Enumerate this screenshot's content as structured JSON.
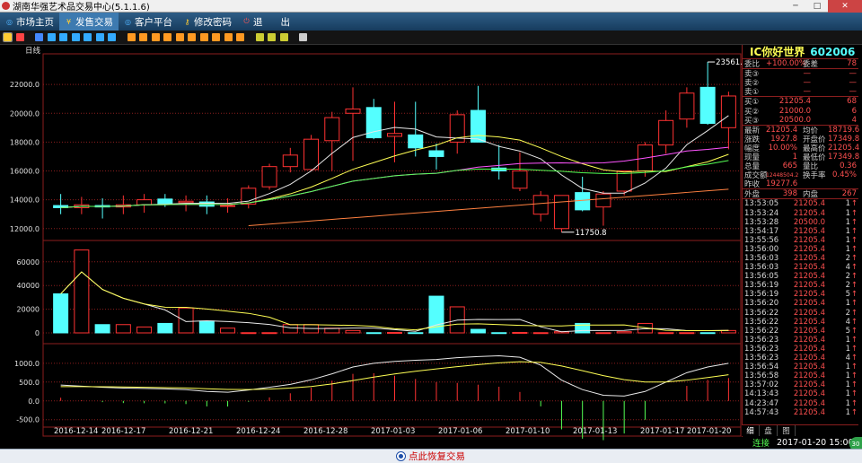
{
  "window": {
    "title": "湖南华强艺术品交易中心(5.1.1.6)"
  },
  "menu": [
    {
      "label": "市场主页",
      "icon": "globe-icon",
      "color": "#4fb3ff"
    },
    {
      "label": "发售交易",
      "icon": "yen-icon",
      "color": "#ffcc33"
    },
    {
      "label": "客户平台",
      "icon": "globe-icon",
      "color": "#4fb3ff"
    },
    {
      "label": "修改密码",
      "icon": "key-icon",
      "color": "#ffcc33"
    },
    {
      "label": "退",
      "icon": "power-icon",
      "color": "#ff5555"
    },
    {
      "label": "出",
      "icon": "",
      "color": ""
    }
  ],
  "toolbar": {
    "icons": [
      "bar-chart-icon",
      "line-chart-icon",
      "calendar-icon",
      "calendar-icon",
      "calendar-icon",
      "calendar-icon",
      "calendar-icon",
      "calendar-icon",
      "close-icon",
      "period-icon",
      "period-icon",
      "period-icon",
      "period-icon",
      "period-icon",
      "period-icon",
      "period-icon",
      "period-icon",
      "period-icon",
      "period-icon",
      "zoom-in-icon",
      "zoom-out-icon",
      "pencil-icon",
      "gear-icon"
    ]
  },
  "chart": {
    "period_label": "日线",
    "price_ticks": [
      "22000.0",
      "20000.0",
      "18000.0",
      "16000.0",
      "14000.0",
      "12000.0"
    ],
    "volume_ticks": [
      "60000",
      "40000",
      "20000",
      "0"
    ],
    "macd_ticks": [
      "1000.0",
      "500.0",
      "0.0",
      "-500.0"
    ],
    "max_label": "23561.6",
    "min_label": "11750.8",
    "dates": [
      "2016-12-14",
      "2016-12-17",
      "2016-12-21",
      "2016-12-24",
      "2016-12-28",
      "2017-01-03",
      "2017-01-06",
      "2017-01-10",
      "2017-01-13",
      "2017-01-17",
      "2017-01-20"
    ]
  },
  "chart_data": {
    "type": "candlestick",
    "y_range": [
      11300,
      24000
    ],
    "candles": [
      {
        "o": 13600,
        "h": 14400,
        "l": 13000,
        "c": 13450
      },
      {
        "o": 13450,
        "h": 14200,
        "l": 13000,
        "c": 13650
      },
      {
        "o": 13600,
        "h": 14100,
        "l": 12700,
        "c": 13500
      },
      {
        "o": 13500,
        "h": 14300,
        "l": 13000,
        "c": 13650
      },
      {
        "o": 13650,
        "h": 14400,
        "l": 13100,
        "c": 14000
      },
      {
        "o": 14050,
        "h": 14400,
        "l": 13500,
        "c": 13700
      },
      {
        "o": 13800,
        "h": 14300,
        "l": 13200,
        "c": 13900
      },
      {
        "o": 13850,
        "h": 14300,
        "l": 13000,
        "c": 13550
      },
      {
        "o": 13600,
        "h": 14100,
        "l": 13100,
        "c": 13600
      },
      {
        "o": 13700,
        "h": 15000,
        "l": 13400,
        "c": 14800
      },
      {
        "o": 14900,
        "h": 16500,
        "l": 14700,
        "c": 16300
      },
      {
        "o": 16300,
        "h": 17600,
        "l": 15900,
        "c": 17100
      },
      {
        "o": 16100,
        "h": 18500,
        "l": 16000,
        "c": 18200
      },
      {
        "o": 18100,
        "h": 20100,
        "l": 16000,
        "c": 19700
      },
      {
        "o": 20000,
        "h": 21800,
        "l": 16700,
        "c": 20300
      },
      {
        "o": 20400,
        "h": 21000,
        "l": 18200,
        "c": 18300
      },
      {
        "o": 18400,
        "h": 20800,
        "l": 16600,
        "c": 18600
      },
      {
        "o": 18500,
        "h": 20800,
        "l": 17000,
        "c": 17600
      },
      {
        "o": 17400,
        "h": 17900,
        "l": 16100,
        "c": 17000
      },
      {
        "o": 18000,
        "h": 20200,
        "l": 17200,
        "c": 19900
      },
      {
        "o": 20200,
        "h": 21900,
        "l": 18000,
        "c": 18000
      },
      {
        "o": 16200,
        "h": 17800,
        "l": 15400,
        "c": 16000
      },
      {
        "o": 14800,
        "h": 17300,
        "l": 14600,
        "c": 16000
      },
      {
        "o": 13000,
        "h": 14600,
        "l": 12500,
        "c": 14300
      },
      {
        "o": 12000,
        "h": 14300,
        "l": 11750.8,
        "c": 14300
      },
      {
        "o": 14500,
        "h": 15600,
        "l": 13200,
        "c": 13300
      },
      {
        "o": 13500,
        "h": 14600,
        "l": 12200,
        "c": 14400
      },
      {
        "o": 14600,
        "h": 16000,
        "l": 14300,
        "c": 16000
      },
      {
        "o": 16000,
        "h": 18000,
        "l": 15600,
        "c": 17800
      },
      {
        "o": 17800,
        "h": 20200,
        "l": 17200,
        "c": 19500
      },
      {
        "o": 19600,
        "h": 21800,
        "l": 19000,
        "c": 21400
      },
      {
        "o": 21800,
        "h": 23561.6,
        "l": 19200,
        "c": 19300
      },
      {
        "o": 19000,
        "h": 21500,
        "l": 17500,
        "c": 21200
      }
    ],
    "volume": [
      33000,
      70000,
      7000,
      7000,
      5000,
      8000,
      21000,
      10000,
      4000,
      200,
      200,
      7000,
      7000,
      4000,
      2000,
      200,
      400,
      200,
      31000,
      22000,
      3000,
      200,
      400,
      200,
      1000,
      8000,
      200,
      1000,
      8000,
      200,
      200,
      200,
      2000
    ],
    "volume_range": [
      0,
      75000
    ],
    "macd": [
      420,
      390,
      360,
      340,
      330,
      320,
      300,
      250,
      230,
      290,
      360,
      440,
      560,
      720,
      900,
      1000,
      1050,
      1080,
      1100,
      1150,
      1180,
      1200,
      1160,
      950,
      550,
      300,
      150,
      130,
      250,
      500,
      750,
      900,
      1000
    ],
    "macd_range": [
      -650,
      1450
    ]
  },
  "quote": {
    "name": "IC你好世界",
    "code": "602006",
    "weibi_label": "委比",
    "weibi": "+100.00%",
    "weicha_label": "委差",
    "weicha": "78",
    "sell3_label": "卖③",
    "sell3": "—",
    "sell3v": "—",
    "sell2_label": "卖②",
    "sell2": "—",
    "sell2v": "—",
    "sell1_label": "卖①",
    "sell1": "—",
    "sell1v": "—",
    "buy1_label": "买①",
    "buy1": "21205.4",
    "buy1v": "68",
    "buy2_label": "买②",
    "buy2": "21000.0",
    "buy2v": "6",
    "buy3_label": "买③",
    "buy3": "20500.0",
    "buy3v": "4",
    "last_label": "最新",
    "last": "21205.4",
    "avg_label": "均价",
    "avg": "18719.6",
    "chg_label": "涨跌",
    "chg": "1927.8",
    "open_label": "开盘价",
    "open": "17349.8",
    "pct_label": "幅度",
    "pct": "10.00%",
    "high_label": "最高价",
    "high": "21205.4",
    "cur_label": "现量",
    "cur": "1",
    "low_label": "最低价",
    "low": "17349.8",
    "total_label": "总量",
    "total": "665",
    "ratio_label": "量比",
    "ratio": "0.36",
    "amt_label": "成交额",
    "amt": "12448504.2",
    "turn_label": "换手率",
    "turn": "0.45%",
    "prev_label": "昨收",
    "prev": "19277.6",
    "out_label": "外盘",
    "out": "398",
    "in_label": "内盘",
    "in": "267"
  },
  "ticks": [
    {
      "t": "13:53:05",
      "p": "21205.4",
      "v": "1"
    },
    {
      "t": "13:53:24",
      "p": "21205.4",
      "v": "1"
    },
    {
      "t": "13:53:28",
      "p": "20500.0",
      "v": "1"
    },
    {
      "t": "13:54:17",
      "p": "21205.4",
      "v": "1"
    },
    {
      "t": "13:55:56",
      "p": "21205.4",
      "v": "1"
    },
    {
      "t": "13:56:00",
      "p": "21205.4",
      "v": "1"
    },
    {
      "t": "13:56:03",
      "p": "21205.4",
      "v": "2"
    },
    {
      "t": "13:56:03",
      "p": "21205.4",
      "v": "4"
    },
    {
      "t": "13:56:05",
      "p": "21205.4",
      "v": "2"
    },
    {
      "t": "13:56:19",
      "p": "21205.4",
      "v": "2"
    },
    {
      "t": "13:56:19",
      "p": "21205.4",
      "v": "5"
    },
    {
      "t": "13:56:20",
      "p": "21205.4",
      "v": "1"
    },
    {
      "t": "13:56:22",
      "p": "21205.4",
      "v": "2"
    },
    {
      "t": "13:56:22",
      "p": "21205.4",
      "v": "4"
    },
    {
      "t": "13:56:22",
      "p": "21205.4",
      "v": "5"
    },
    {
      "t": "13:56:23",
      "p": "21205.4",
      "v": "1"
    },
    {
      "t": "13:56:23",
      "p": "21205.4",
      "v": "1"
    },
    {
      "t": "13:56:23",
      "p": "21205.4",
      "v": "4"
    },
    {
      "t": "13:56:54",
      "p": "21205.4",
      "v": "1"
    },
    {
      "t": "13:56:58",
      "p": "21205.4",
      "v": "1"
    },
    {
      "t": "13:57:02",
      "p": "21205.4",
      "v": "1"
    },
    {
      "t": "14:13:43",
      "p": "21205.4",
      "v": "1"
    },
    {
      "t": "14:23:47",
      "p": "21205.4",
      "v": "1"
    },
    {
      "t": "14:57:43",
      "p": "21205.4",
      "v": "1"
    }
  ],
  "panel_tabs": [
    "细",
    "盘",
    "图"
  ],
  "status": {
    "conn": "连接",
    "datetime": "2017-01-20 15:00",
    "corner": "30"
  },
  "bottom": {
    "label": "点此恢复交易"
  },
  "colors": {
    "up": "#ff3232",
    "down": "#54ffff",
    "grid": "#8b1e1e"
  }
}
